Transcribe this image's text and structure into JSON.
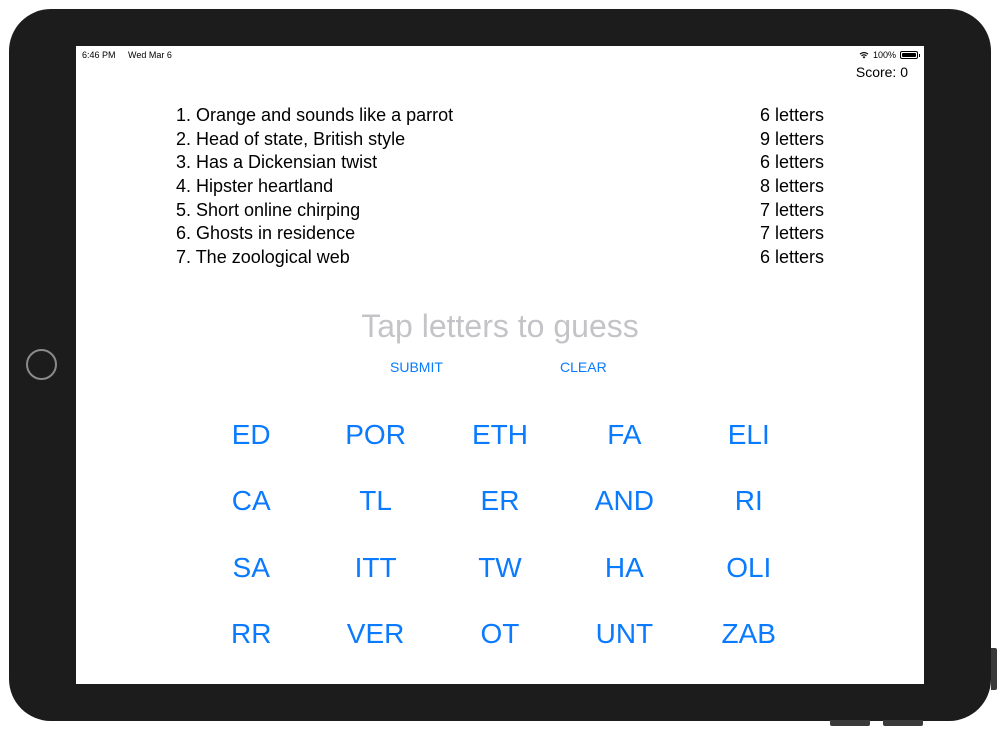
{
  "status_bar": {
    "time": "6:46 PM",
    "date": "Wed Mar 6",
    "battery": "100%",
    "icons": [
      "wifi-icon",
      "battery-icon"
    ]
  },
  "score": {
    "label": "Score: 0",
    "value": 0
  },
  "clues": [
    {
      "text": "1. Orange and sounds like a parrot",
      "length": "6 letters"
    },
    {
      "text": "2. Head of state, British style",
      "length": "9 letters"
    },
    {
      "text": "3. Has a Dickensian twist",
      "length": "6 letters"
    },
    {
      "text": "4. Hipster heartland",
      "length": "8 letters"
    },
    {
      "text": "5. Short online chirping",
      "length": "7 letters"
    },
    {
      "text": "6. Ghosts in residence",
      "length": "7 letters"
    },
    {
      "text": "7. The zoological web",
      "length": "6 letters"
    }
  ],
  "guess": {
    "placeholder": "Tap letters to guess"
  },
  "actions": {
    "submit_label": "SUBMIT",
    "clear_label": "CLEAR"
  },
  "tiles": [
    [
      "ED",
      "POR",
      "ETH",
      "FA",
      "ELI"
    ],
    [
      "CA",
      "TL",
      "ER",
      "AND",
      "RI"
    ],
    [
      "SA",
      "ITT",
      "TW",
      "HA",
      "OLI"
    ],
    [
      "RR",
      "VER",
      "OT",
      "UNT",
      "ZAB"
    ]
  ],
  "colors": {
    "accent": "#0a7aff",
    "placeholder": "#c4c4c8",
    "device_frame": "#1c1c1c"
  }
}
